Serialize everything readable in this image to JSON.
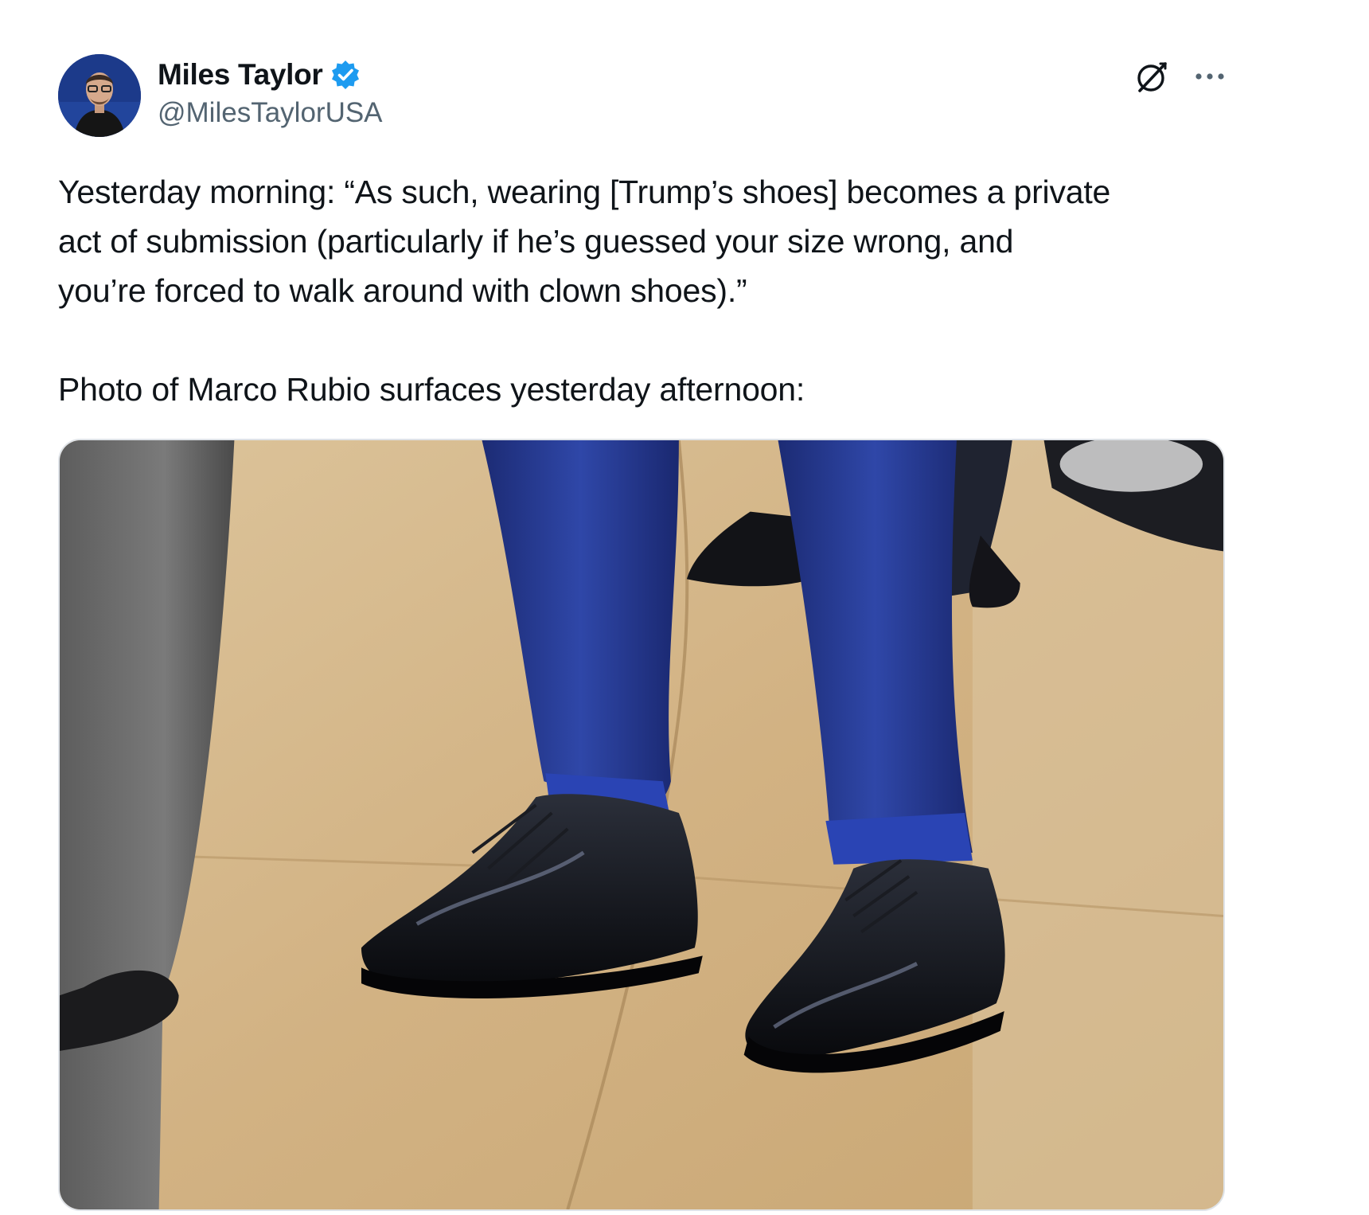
{
  "author": {
    "display_name": "Miles Taylor",
    "handle": "@MilesTaylorUSA",
    "verified": true,
    "avatar_icon": "profile-photo"
  },
  "actions": {
    "grok_icon": "grok-icon",
    "more_icon": "more-options-icon"
  },
  "tweet": {
    "lines": [
      "Yesterday morning: “As such, wearing [Trump’s shoes] becomes a private",
      "act of submission (particularly if he’s guessed your size wrong, and",
      "you’re forced to walk around with clown shoes).”",
      "Photo of Marco Rubio surfaces yesterday afternoon:"
    ]
  },
  "media": {
    "icon": "photo-of-shoes"
  },
  "colors": {
    "text": "#0f1419",
    "secondary_text": "#536471",
    "verified_badge": "#1d9bf0",
    "floor": "#d7b988",
    "suit": "#24378a"
  }
}
